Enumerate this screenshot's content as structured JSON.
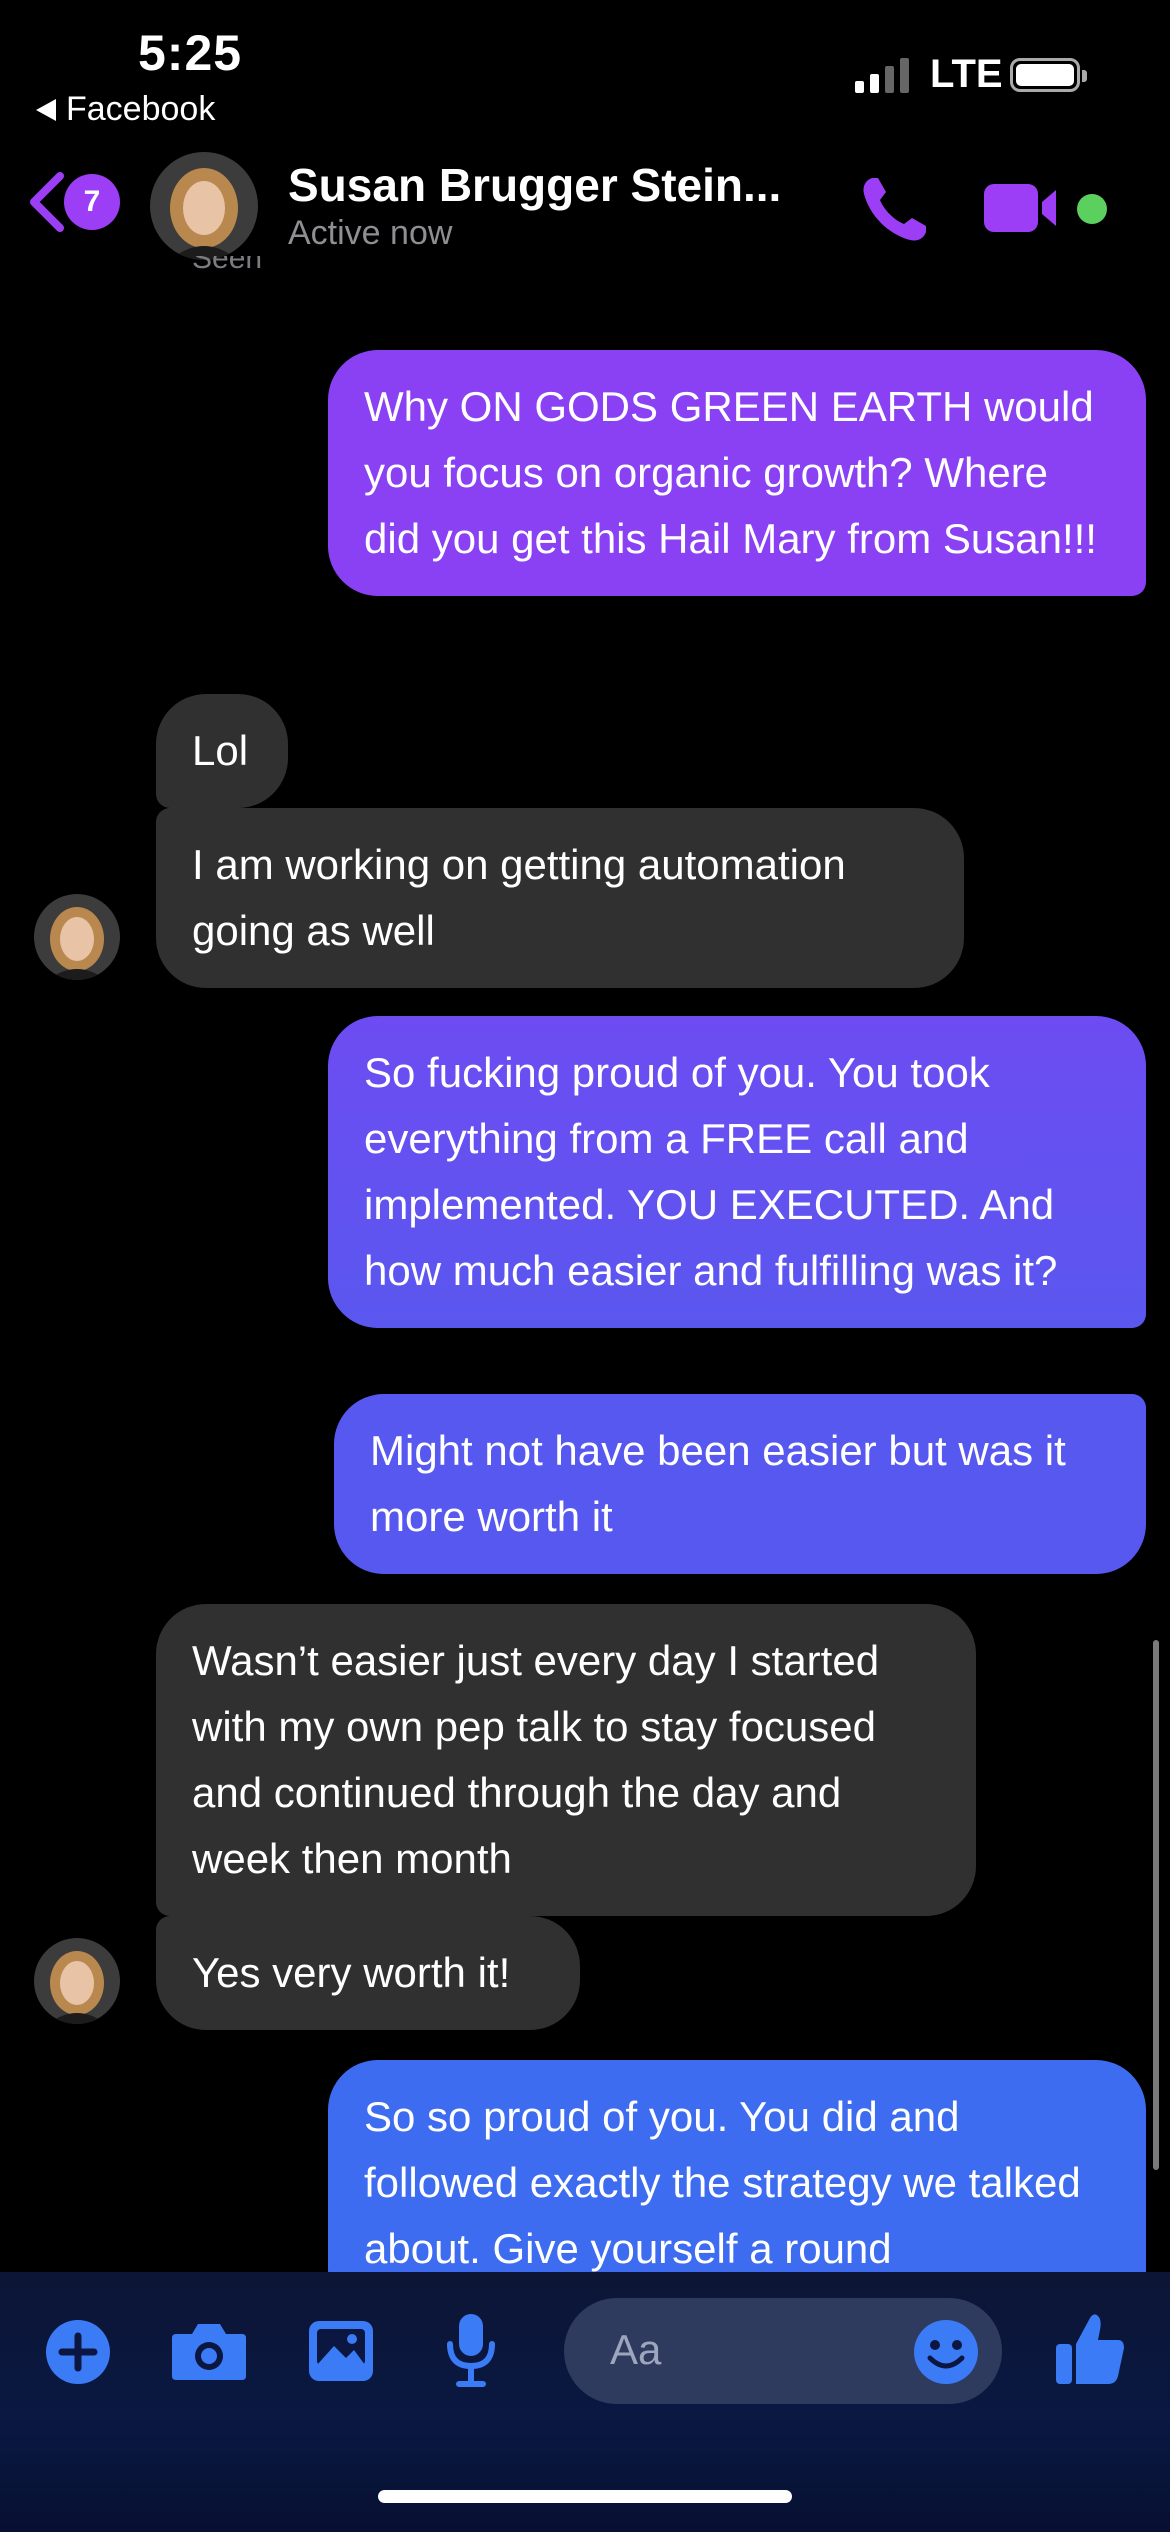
{
  "status_bar": {
    "time": "5:25",
    "back_app": "Facebook",
    "network": "LTE"
  },
  "header": {
    "unread_count": "7",
    "contact_name": "Susan Brugger Stein...",
    "contact_status": "Active now",
    "seen_label": "Seen"
  },
  "messages": [
    {
      "side": "out",
      "text": "Why ON GODS GREEN EARTH would you focus on organic growth? Where did you get this Hail Mary from Susan!!!"
    },
    {
      "side": "in",
      "text": "Lol"
    },
    {
      "side": "in",
      "text": "I am working on getting automation going as well"
    },
    {
      "side": "out",
      "text": "So fucking proud of you. You took everything from a FREE call and implemented. YOU EXECUTED. And how much easier and fulfilling was it?"
    },
    {
      "side": "out",
      "text": "Might not have been easier but was it more worth it"
    },
    {
      "side": "in",
      "text": "Wasn’t easier just every day I started with my own pep talk to stay focused and continued through the day and week then month"
    },
    {
      "side": "in",
      "text": "Yes very worth it!"
    },
    {
      "side": "out",
      "text": "So so proud of you. You did and followed exactly the strategy we talked about. Give yourself a round"
    }
  ],
  "composer": {
    "placeholder": "Aa",
    "icons": [
      "plus-icon",
      "camera-icon",
      "photo-icon",
      "microphone-icon",
      "emoji-icon",
      "thumbs-up-icon"
    ]
  },
  "colors": {
    "accent_purple": "#9b3ef5",
    "bubble_out_top": "#8a41f4",
    "bubble_out_mid": "#5b56ef",
    "bubble_out_bottom": "#3d6cf0",
    "bubble_in": "#303030",
    "composer_icon": "#3b7bf5",
    "online_green": "#5bd05f"
  }
}
